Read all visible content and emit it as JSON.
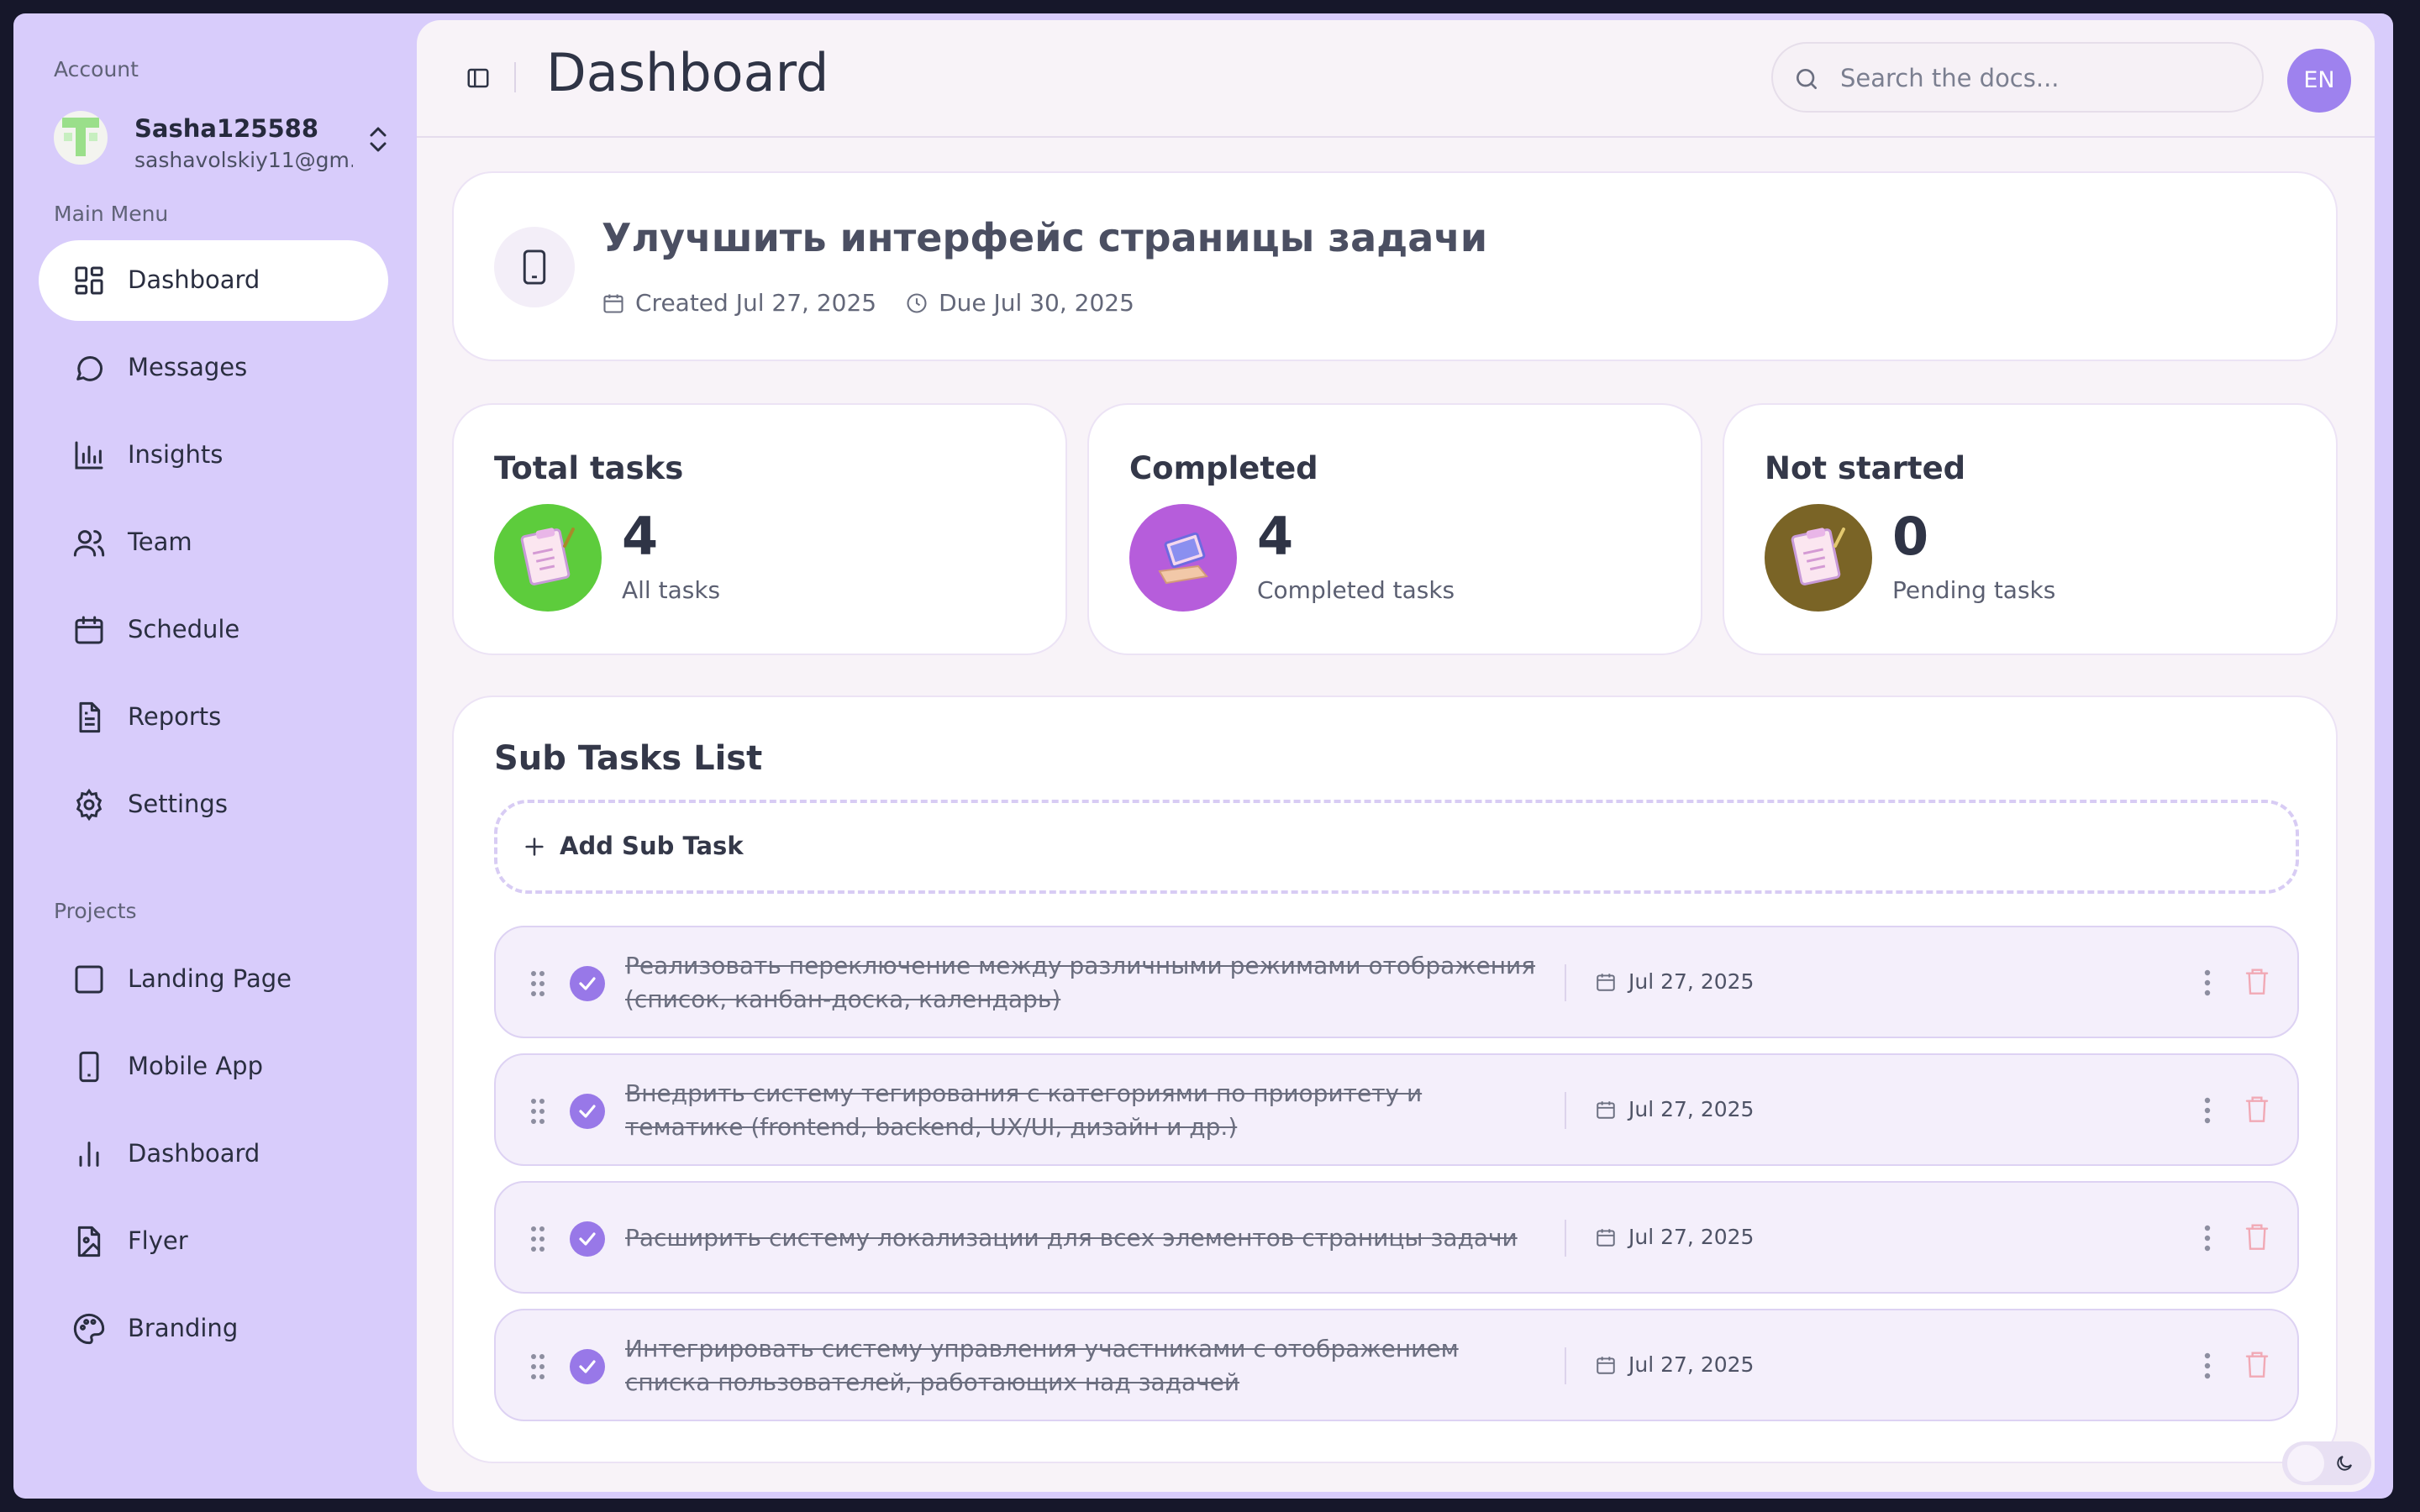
{
  "sidebar": {
    "account_label": "Account",
    "user_name": "Sasha125588",
    "user_email": "sashavolskiy11@gm...",
    "main_menu_label": "Main Menu",
    "items": [
      {
        "label": "Dashboard",
        "icon": "dashboard-icon",
        "active": true
      },
      {
        "label": "Messages",
        "icon": "message-icon"
      },
      {
        "label": "Insights",
        "icon": "chart-icon"
      },
      {
        "label": "Team",
        "icon": "users-icon"
      },
      {
        "label": "Schedule",
        "icon": "calendar-icon"
      },
      {
        "label": "Reports",
        "icon": "document-icon"
      },
      {
        "label": "Settings",
        "icon": "gear-icon"
      }
    ],
    "projects_label": "Projects",
    "projects": [
      {
        "label": "Landing Page",
        "icon": "square-icon"
      },
      {
        "label": "Mobile App",
        "icon": "phone-icon"
      },
      {
        "label": "Dashboard",
        "icon": "bar-chart-icon"
      },
      {
        "label": "Flyer",
        "icon": "image-file-icon"
      },
      {
        "label": "Branding",
        "icon": "palette-icon"
      }
    ]
  },
  "header": {
    "title": "Dashboard",
    "search_placeholder": "Search the docs...",
    "language": "EN"
  },
  "task": {
    "title": "Улучшить интерфейс страницы задачи",
    "created": "Created Jul 27, 2025",
    "due": "Due Jul 30, 2025"
  },
  "stats": [
    {
      "title": "Total tasks",
      "value": "4",
      "subtitle": "All tasks",
      "color": "#5dcc3c"
    },
    {
      "title": "Completed",
      "value": "4",
      "subtitle": "Completed tasks",
      "color": "#b65ddb"
    },
    {
      "title": "Not started",
      "value": "0",
      "subtitle": "Pending tasks",
      "color": "#7a6426"
    }
  ],
  "subtasks": {
    "title": "Sub Tasks List",
    "add_label": "Add Sub Task",
    "items": [
      {
        "text": "Реализовать переключение между различными режимами отображения (список, канбан-доска, календарь)",
        "date": "Jul 27, 2025",
        "completed": true
      },
      {
        "text": "Внедрить систему тегирования с категориями по приоритету и тематике (frontend, backend, UX/UI, дизайн и др.)",
        "date": "Jul 27, 2025",
        "completed": true
      },
      {
        "text": "Расширить систему локализации для всех элементов страницы задачи",
        "date": "Jul 27, 2025",
        "completed": true
      },
      {
        "text": "Интегрировать систему управления участниками с отображением списка пользователей, работающих над задачей",
        "date": "Jul 27, 2025",
        "completed": true
      }
    ]
  },
  "colors": {
    "sidebar_bg": "#d8ccfb",
    "accent": "#9878e8",
    "trash": "#f1a9b5"
  }
}
